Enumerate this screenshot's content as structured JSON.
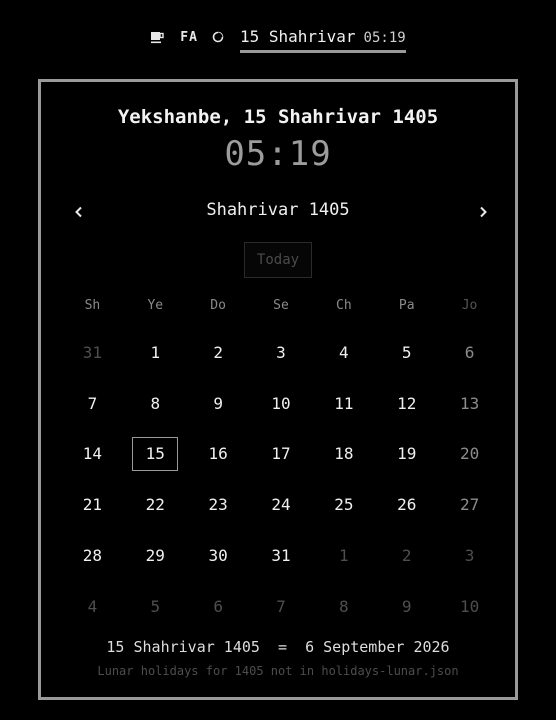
{
  "topbar": {
    "tray_icon": "coffee-cup-icon",
    "lang": "FA",
    "theme_icon": "moon-icon",
    "date": "15 Shahrivar",
    "time": "05:19"
  },
  "calendar": {
    "full_date": "Yekshanbe, 15 Shahrivar 1405",
    "clock": "05:19",
    "month_title": "Shahrivar 1405",
    "prev_icon": "chevron-left-icon",
    "next_icon": "chevron-right-icon",
    "today_label": "Today",
    "weekdays": [
      "Sh",
      "Ye",
      "Do",
      "Se",
      "Ch",
      "Pa",
      "Jo"
    ],
    "days": [
      {
        "label": "31",
        "other": true
      },
      {
        "label": "1"
      },
      {
        "label": "2"
      },
      {
        "label": "3"
      },
      {
        "label": "4"
      },
      {
        "label": "5"
      },
      {
        "label": "6"
      },
      {
        "label": "7"
      },
      {
        "label": "8"
      },
      {
        "label": "9"
      },
      {
        "label": "10"
      },
      {
        "label": "11"
      },
      {
        "label": "12"
      },
      {
        "label": "13"
      },
      {
        "label": "14"
      },
      {
        "label": "15",
        "selected": true
      },
      {
        "label": "16"
      },
      {
        "label": "17"
      },
      {
        "label": "18"
      },
      {
        "label": "19"
      },
      {
        "label": "20"
      },
      {
        "label": "21"
      },
      {
        "label": "22"
      },
      {
        "label": "23"
      },
      {
        "label": "24"
      },
      {
        "label": "25"
      },
      {
        "label": "26"
      },
      {
        "label": "27"
      },
      {
        "label": "28"
      },
      {
        "label": "29"
      },
      {
        "label": "30"
      },
      {
        "label": "31"
      },
      {
        "label": "1",
        "other": true
      },
      {
        "label": "2",
        "other": true
      },
      {
        "label": "3",
        "other": true
      },
      {
        "label": "4",
        "other": true
      },
      {
        "label": "5",
        "other": true
      },
      {
        "label": "6",
        "other": true
      },
      {
        "label": "7",
        "other": true
      },
      {
        "label": "8",
        "other": true
      },
      {
        "label": "9",
        "other": true
      },
      {
        "label": "10",
        "other": true
      }
    ],
    "conversion": "15 Shahrivar 1405  =  6 September 2026",
    "holiday_note": "Lunar holidays for 1405 not in holidays-lunar.json"
  },
  "colors": {
    "background": "#000000",
    "border": "#9a9a9a",
    "text": "#f0f0f0",
    "muted": "#4e4e4e"
  }
}
